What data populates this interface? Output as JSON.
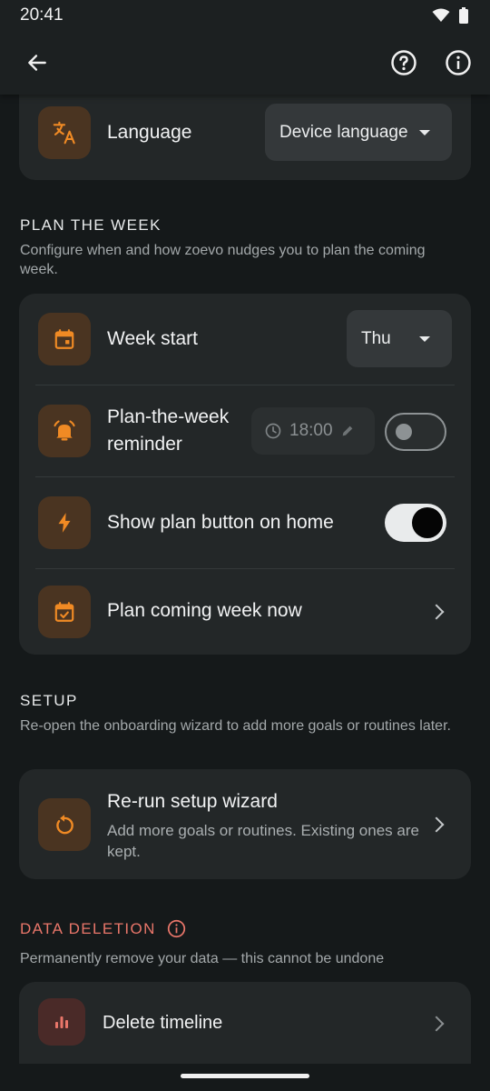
{
  "status_bar": {
    "time": "20:41"
  },
  "language_row": {
    "label": "Language",
    "value": "Device language"
  },
  "plan_section": {
    "header": "PLAN THE WEEK",
    "description": "Configure when and how zoevo nudges you to plan the coming week.",
    "rows": {
      "week_start": {
        "label": "Week start",
        "value": "Thu"
      },
      "reminder": {
        "label_line1": "Plan-the-week",
        "label_line2": "reminder",
        "time": "18:00",
        "enabled": false
      },
      "show_plan_button": {
        "label": "Show plan button on home",
        "enabled": true
      },
      "plan_now": {
        "label": "Plan coming week now"
      }
    }
  },
  "setup_section": {
    "header": "SETUP",
    "description": "Re-open the onboarding wizard to add more goals or routines later.",
    "rerun": {
      "label": "Re-run setup wizard",
      "sub": "Add more goals or routines. Existing ones are kept."
    }
  },
  "data_deletion_section": {
    "header": "DATA DELETION",
    "description": "Permanently remove your data — this cannot be undone",
    "delete_timeline": {
      "label": "Delete timeline"
    }
  },
  "colors": {
    "accent": "#f08a24",
    "danger": "#e9766a",
    "background": "#15191a",
    "card": "#232728"
  }
}
